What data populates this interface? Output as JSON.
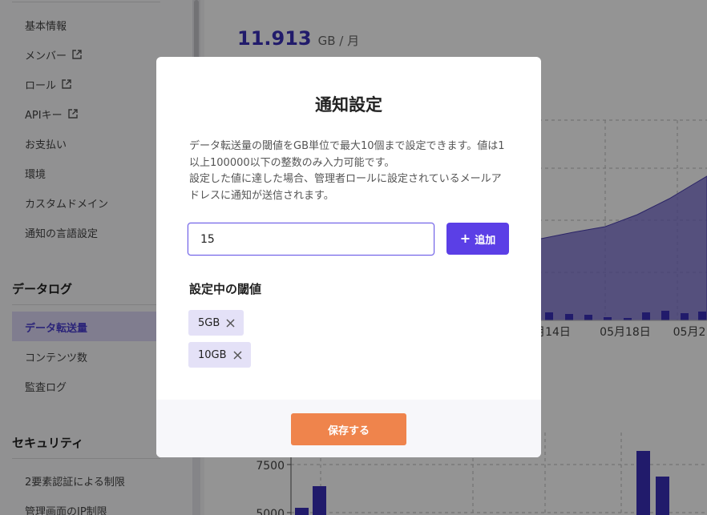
{
  "sidebar": {
    "items": [
      {
        "label": "基本情報",
        "external": false
      },
      {
        "label": "メンバー",
        "external": true
      },
      {
        "label": "ロール",
        "external": true
      },
      {
        "label": "APIキー",
        "external": true
      },
      {
        "label": "お支払い",
        "external": false
      },
      {
        "label": "環境",
        "external": false
      },
      {
        "label": "カスタムドメイン",
        "external": false
      },
      {
        "label": "通知の言語設定",
        "external": false
      }
    ],
    "datalog": {
      "title": "データログ",
      "items": [
        "データ転送量",
        "コンテンツ数",
        "監査ログ"
      ],
      "active": "データ転送量"
    },
    "security": {
      "title": "セキュリティ",
      "items": [
        "2要素認証による制限",
        "管理画面のIP制限"
      ]
    }
  },
  "main": {
    "metric_value": "11.913",
    "metric_unit": "GB / 月",
    "chart_data": [
      {
        "type": "area",
        "x_tick_labels": [
          "月14日",
          "05月18日",
          "05月2"
        ],
        "title": "",
        "xlabel": "",
        "ylabel": ""
      },
      {
        "type": "bar",
        "y_tick_labels": [
          "7500",
          "5000"
        ],
        "title": "",
        "xlabel": "",
        "ylabel": ""
      }
    ]
  },
  "modal": {
    "title": "通知設定",
    "description_line1": "データ転送量の閾値をGB単位で最大10個まで設定できます。値は1以上100000以下の整数のみ入力可能です。",
    "description_line2": "設定した値に達した場合、管理者ロールに設定されているメールアドレスに通知が送信されます。",
    "input_value": "15",
    "add_label": "追加",
    "section_heading": "設定中の閾値",
    "thresholds": [
      "5GB",
      "10GB"
    ],
    "save_label": "保存する"
  },
  "colors": {
    "accent": "#5b3fe6",
    "save": "#ef844c",
    "tag_bg": "#e4e1f7",
    "chart_fill": "#6f63c9",
    "chart_bar": "#3a2fb8"
  },
  "icons": {
    "external_link": "external-link-icon",
    "plus": "plus-icon",
    "remove": "close-icon"
  }
}
